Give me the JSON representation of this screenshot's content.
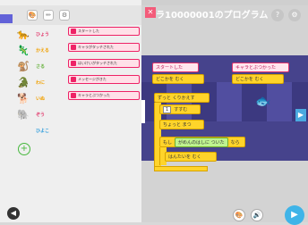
{
  "project": {
    "title": "ラ10000001のプログラム",
    "close_glyph": "✕",
    "help_glyph": "?",
    "settings_glyph": "⚙"
  },
  "toolbar": {
    "tools": [
      "🎨",
      "✏",
      "⚙"
    ]
  },
  "sprites": [
    "🐆",
    "🦎",
    "🐒",
    "🐊",
    "🐕",
    "🐘"
  ],
  "categories": [
    "ひょう",
    "かえる",
    "さる",
    "わに",
    "いぬ",
    "ぞう",
    "ひよこ"
  ],
  "palette_blocks": [
    "スタートした",
    "キャラがタッチされた",
    "はいけいがタッチされた",
    "メッセージがきた",
    "キャラとぶつかった"
  ],
  "script_blocks": {
    "start": "スタートした",
    "collide": "キャラとぶつかった",
    "where": "どこかを むく",
    "where2": "どこかを むく",
    "loop": "ずっと くりかえす",
    "steps": "すすむ",
    "wait": "ちょっと まつ",
    "if": "もし",
    "cond": "がめんのはしに ついた",
    "then": "なら",
    "turn": "はんたいを むく",
    "one": "1"
  }
}
